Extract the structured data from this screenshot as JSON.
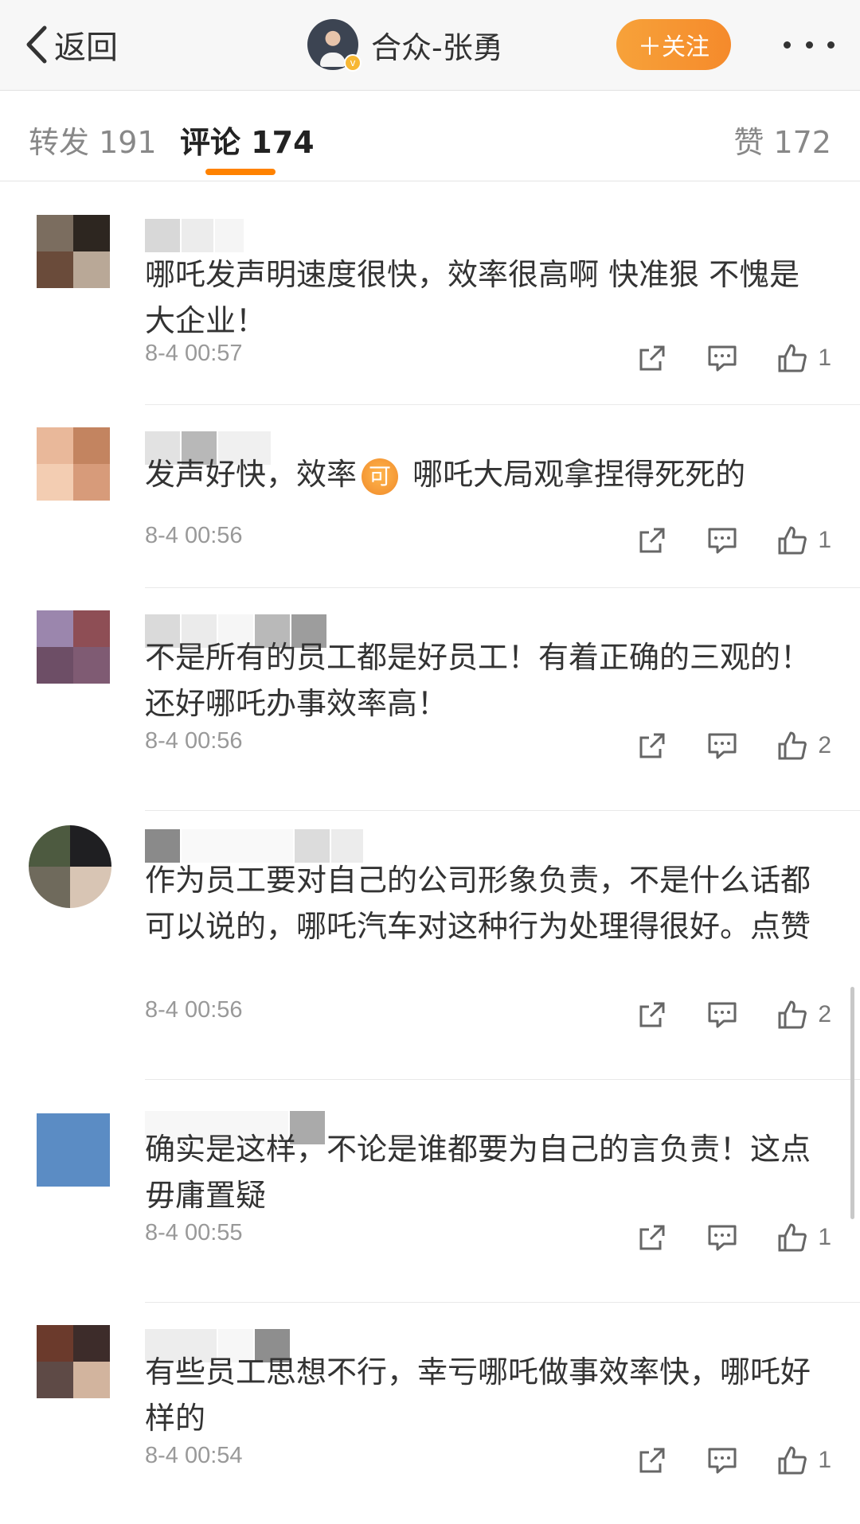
{
  "header": {
    "back_label": "返回",
    "user_name": "合众-张勇",
    "follow_label": "＋关注",
    "verified_badge": "v"
  },
  "tabs": {
    "reposts": "转发 191",
    "comments": "评论 174",
    "likes": "赞 172"
  },
  "colors": {
    "accent": "#ff8200",
    "follow_button": "#f5922d",
    "text_secondary": "#999999"
  },
  "icons": {
    "back": "chevron-left-icon",
    "more": "more-dots-icon",
    "share": "share-icon",
    "reply": "comment-icon",
    "like": "thumbs-up-icon"
  },
  "comments": [
    {
      "text": "哪吒发声明速度很快，效率很高啊 快准狠 不愧是大企业！",
      "time": "8-4 00:57",
      "likes": "1"
    },
    {
      "text_before": "发声好快，效率",
      "emoji": "可",
      "text_after": "哪吒大局观拿捏得死死的",
      "time": "8-4 00:56",
      "likes": "1"
    },
    {
      "text": "不是所有的员工都是好员工！有着正确的三观的！还好哪吒办事效率高！",
      "time": "8-4 00:56",
      "likes": "2"
    },
    {
      "text": "作为员工要对自己的公司形象负责，不是什么话都可以说的，哪吒汽车对这种行为处理得很好。点赞",
      "time": "8-4 00:56",
      "likes": "2"
    },
    {
      "text": "确实是这样，不论是谁都要为自己的言负责！这点毋庸置疑",
      "time": "8-4 00:55",
      "likes": "1"
    },
    {
      "text": "有些员工思想不行，幸亏哪吒做事效率快，哪吒好样的",
      "time": "8-4 00:54",
      "likes": "1"
    }
  ]
}
